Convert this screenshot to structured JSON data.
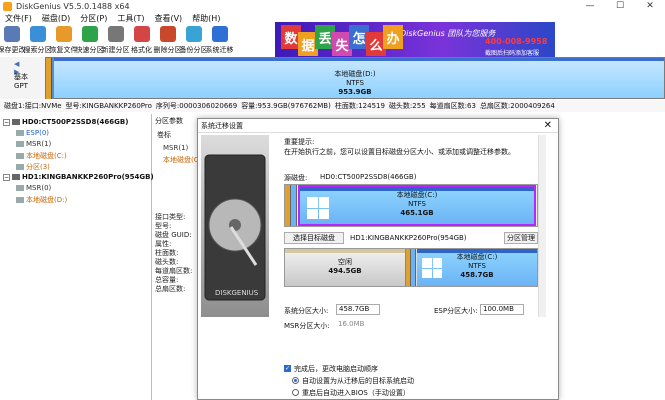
{
  "window": {
    "title": "DiskGenius V5.5.0.1488 x64"
  },
  "menu": [
    "文件(F)",
    "磁盘(D)",
    "分区(P)",
    "工具(T)",
    "查看(V)",
    "帮助(H)"
  ],
  "toolbar": [
    {
      "label": "保存更改",
      "icon": "save-icon",
      "color": "#5a7ab5"
    },
    {
      "label": "搜索分区",
      "icon": "search-partition-icon",
      "color": "#3b8fd6"
    },
    {
      "label": "恢复文件",
      "icon": "recover-file-icon",
      "color": "#e69a2a"
    },
    {
      "label": "快速分区",
      "icon": "quick-partition-icon",
      "color": "#2fa34a"
    },
    {
      "label": "新建分区",
      "icon": "new-partition-icon",
      "color": "#777777"
    },
    {
      "label": "格式化",
      "icon": "format-icon",
      "color": "#d64545"
    },
    {
      "label": "删除分区",
      "icon": "delete-partition-icon",
      "color": "#c9482c"
    },
    {
      "label": "备份分区",
      "icon": "backup-partition-icon",
      "color": "#3aa3d6"
    },
    {
      "label": "系统迁移",
      "icon": "system-migrate-icon",
      "color": "#2f6fd6"
    }
  ],
  "ad": {
    "tiles": [
      "数",
      "据",
      "丢",
      "失",
      "怎",
      "么",
      "办"
    ],
    "slogan": "DiskGenius 团队为您服务",
    "phone": "400-008-9958",
    "note": "截图后扫码添加客服"
  },
  "diskbar": {
    "disk_label": "基本",
    "disk_type": "GPT",
    "part_name": "本地磁盘(D:)",
    "part_fs": "NTFS",
    "part_size": "953.9GB"
  },
  "statusline": [
    "磁盘1:接口:NVMe",
    "型号:KINGBANKKP260Pro",
    "序列号:0000306020669",
    "容量:953.9GB(976762MB)",
    "柱面数:124519",
    "磁头数:255",
    "每道扇区数:63",
    "总扇区数:2000409264"
  ],
  "tree": [
    {
      "label": "HD0:CT500P2SSD8(466GB)",
      "level": 0,
      "type": "disk"
    },
    {
      "label": "ESP(0)",
      "level": 1,
      "type": "part",
      "color": "#2060d0"
    },
    {
      "label": "MSR(1)",
      "level": 1,
      "type": "part",
      "color": "#333333"
    },
    {
      "label": "本地磁盘(C:)",
      "level": 1,
      "type": "part",
      "color": "#c86400"
    },
    {
      "label": "分区(3)",
      "level": 1,
      "type": "part",
      "color": "#c86400"
    },
    {
      "label": "HD1:KINGBANKKP260Pro(954GB)",
      "level": 0,
      "type": "disk"
    },
    {
      "label": "MSR(0)",
      "level": 1,
      "type": "part",
      "color": "#333333"
    },
    {
      "label": "本地磁盘(D:)",
      "level": 1,
      "type": "part",
      "color": "#c86400"
    }
  ],
  "right_panel": {
    "tab": "分区参数",
    "col_label": "卷标",
    "rows": [
      "MSR(1)",
      "本地磁盘(C:)"
    ],
    "info_labels": [
      "接口类型:",
      "型号:",
      "磁盘 GUID:",
      "属性:",
      "柱面数:",
      "磁头数:",
      "每道扇区数:",
      "总容量:",
      "总扇区数:"
    ]
  },
  "dialog": {
    "title": "系统迁移设置",
    "hint_title": "重要提示:",
    "hint_text": "在开始执行之前，您可以设置目标磁盘分区大小、或添加或调整迁移参数。",
    "source_label": "源磁盘:",
    "source_disk": "HD0:CT500P2SSD8(466GB)",
    "src_part": {
      "name": "本地磁盘(C:)",
      "fs": "NTFS",
      "size": "465.1GB"
    },
    "select_target_button": "选择目标磁盘",
    "target_disk": "HD1:KINGBANKKP260Pro(954GB)",
    "manage_button": "分区管理",
    "free": {
      "name": "空闲",
      "size": "494.5GB"
    },
    "dst_part": {
      "name": "本地磁盘(C:)",
      "fs": "NTFS",
      "size": "458.7GB"
    },
    "sys_size_label": "系统分区大小:",
    "sys_size_value": "458.7GB",
    "esp_size_label": "ESP分区大小:",
    "esp_size_value": "100.0MB",
    "msr_size_label": "MSR分区大小:",
    "msr_size_value": "16.0MB",
    "check_label": "完成后，更改电脑启动顺序",
    "radio1": "自动设置为从迁移后的目标系统启动",
    "radio2": "重启后自动进入BIOS（手动设置）"
  }
}
